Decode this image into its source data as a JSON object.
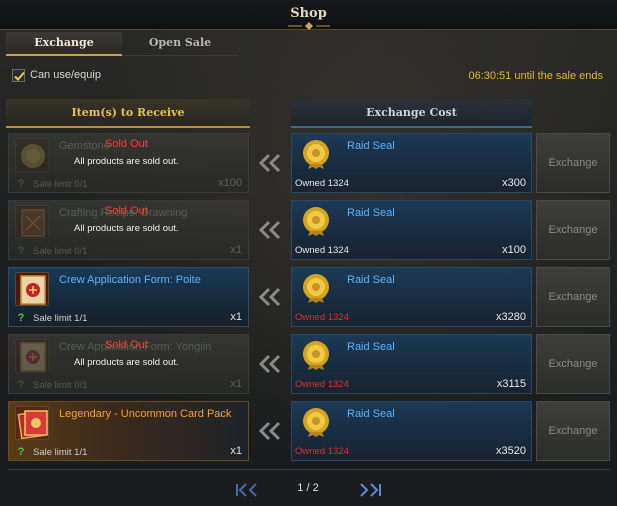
{
  "window": {
    "title": "Shop"
  },
  "tabs": [
    {
      "label": "Exchange",
      "active": true
    },
    {
      "label": "Open Sale",
      "active": false
    }
  ],
  "filter": {
    "label": "Can use/equip",
    "checked": true
  },
  "timer": {
    "text": "06:30:51 until the sale ends"
  },
  "columns": {
    "receive": "Item(s) to Receive",
    "cost": "Exchange Cost"
  },
  "rows": [
    {
      "item": {
        "name": "Gemstone",
        "limit": "Sale limit 0/1",
        "qty": "x100",
        "icon": "gemstone-icon",
        "sold_out": true
      },
      "sold_out": {
        "label": "Sold Out",
        "text": "All products are sold out."
      },
      "cost": {
        "name": "Raid Seal",
        "owned": "Owned 1324",
        "qty": "x300",
        "owned_insufficient": false
      },
      "button": "Exchange"
    },
    {
      "item": {
        "name": "Crafting Recipe: Drawning",
        "limit": "Sale limit 0/1",
        "qty": "x1",
        "icon": "recipe-book-icon",
        "sold_out": true
      },
      "sold_out": {
        "label": "Sold Out",
        "text": "All products are sold out."
      },
      "cost": {
        "name": "Raid Seal",
        "owned": "Owned 1324",
        "qty": "x100",
        "owned_insufficient": false
      },
      "button": "Exchange"
    },
    {
      "item": {
        "name": "Crew Application Form: Poite",
        "limit": "Sale limit 1/1",
        "qty": "x1",
        "icon": "crew-form-icon",
        "sold_out": false
      },
      "cost": {
        "name": "Raid Seal",
        "owned": "Owned 1324",
        "qty": "x3280",
        "owned_insufficient": true
      },
      "button": "Exchange"
    },
    {
      "item": {
        "name": "Crew Application Form: Yongiin",
        "limit": "Sale limit 0/1",
        "qty": "x1",
        "icon": "crew-form-icon",
        "sold_out": true
      },
      "sold_out": {
        "label": "Sold Out",
        "text": "All products are sold out."
      },
      "cost": {
        "name": "Raid Seal",
        "owned": "Owned 1324",
        "qty": "x3115",
        "owned_insufficient": true
      },
      "button": "Exchange"
    },
    {
      "item": {
        "name": "Legendary - Uncommon Card Pack",
        "limit": "Sale limit 1/1",
        "qty": "x1",
        "icon": "card-pack-icon",
        "sold_out": false
      },
      "cost": {
        "name": "Raid Seal",
        "owned": "Owned 1324",
        "qty": "x3520",
        "owned_insufficient": true
      },
      "button": "Exchange"
    }
  ],
  "pager": {
    "text": "1 / 2"
  },
  "colors": {
    "accent_gold": "#e8c24a",
    "name_blue": "#5ab4ff",
    "legendary_orange": "#ff9d2a",
    "warning_red": "#e03030",
    "sold_out_red": "#ff3c32"
  }
}
